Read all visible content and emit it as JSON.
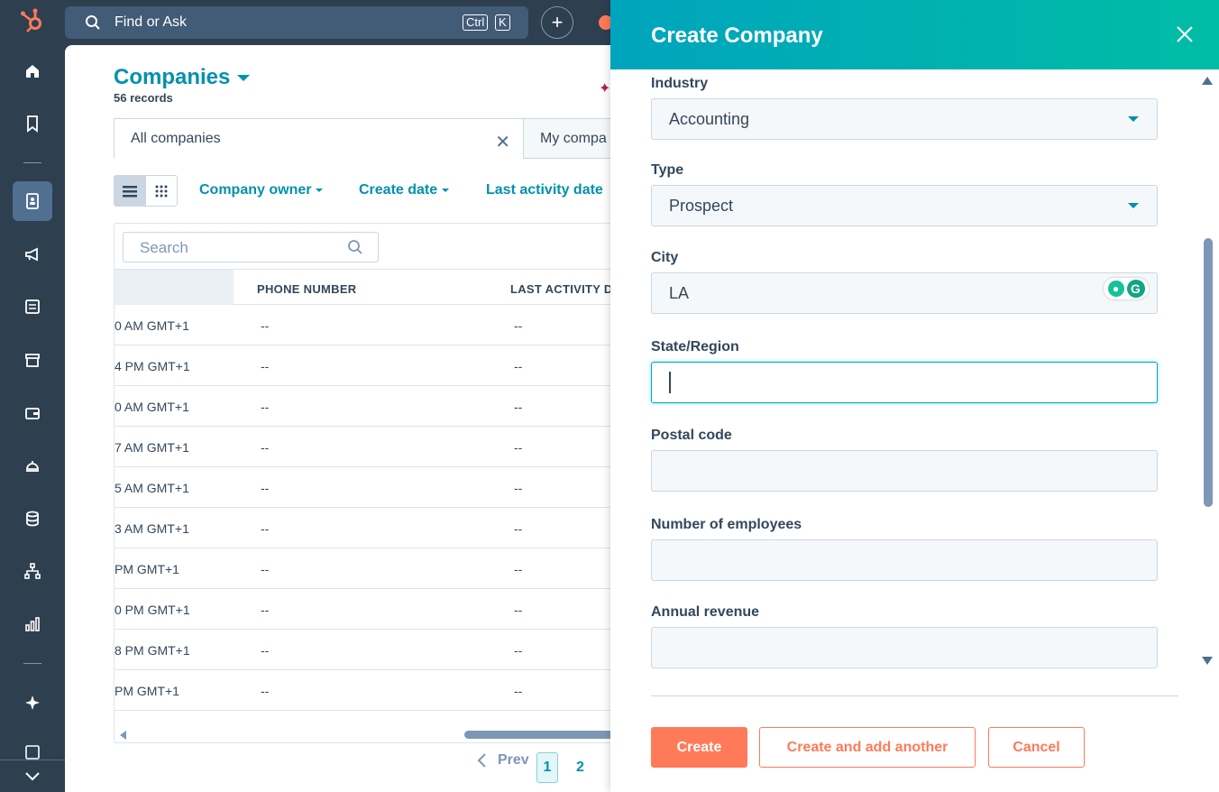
{
  "topbar": {
    "search_text": "Find or Ask",
    "shortcut_ctrl": "Ctrl",
    "shortcut_key": "K",
    "plus_label": "+"
  },
  "page": {
    "title": "Companies",
    "records": "56 records"
  },
  "views": {
    "active": "All companies",
    "other": "My compa"
  },
  "filters": {
    "owner": "Company owner",
    "create_date": "Create date",
    "last_activity": "Last activity date"
  },
  "table": {
    "search_placeholder": "Search",
    "columns": [
      "PHONE NUMBER",
      "LAST ACTIVITY D"
    ],
    "rows": [
      {
        "time": "0 AM GMT+1",
        "phone": "--",
        "activity": "--"
      },
      {
        "time": "4 PM GMT+1",
        "phone": "--",
        "activity": "--"
      },
      {
        "time": "0 AM GMT+1",
        "phone": "--",
        "activity": "--"
      },
      {
        "time": "7 AM GMT+1",
        "phone": "--",
        "activity": "--"
      },
      {
        "time": "5 AM GMT+1",
        "phone": "--",
        "activity": "--"
      },
      {
        "time": "3 AM GMT+1",
        "phone": "--",
        "activity": "--"
      },
      {
        "time": " PM GMT+1",
        "phone": "--",
        "activity": "--"
      },
      {
        "time": "0 PM GMT+1",
        "phone": "--",
        "activity": "--"
      },
      {
        "time": "8 PM GMT+1",
        "phone": "--",
        "activity": "--"
      },
      {
        "time": " PM GMT+1",
        "phone": "--",
        "activity": "--"
      }
    ]
  },
  "pagination": {
    "prev": "Prev",
    "page1": "1",
    "page2": "2"
  },
  "panel": {
    "title": "Create Company",
    "fields": {
      "industry": {
        "label": "Industry",
        "value": "Accounting"
      },
      "type": {
        "label": "Type",
        "value": "Prospect"
      },
      "city": {
        "label": "City",
        "value": "LA"
      },
      "state": {
        "label": "State/Region",
        "value": ""
      },
      "postal": {
        "label": "Postal code",
        "value": ""
      },
      "employees": {
        "label": "Number of employees",
        "value": ""
      },
      "revenue": {
        "label": "Annual revenue",
        "value": ""
      }
    },
    "buttons": {
      "create": "Create",
      "create_another": "Create and add another",
      "cancel": "Cancel"
    }
  },
  "colors": {
    "nav_bg": "#2e3f50",
    "accent": "#0091ae",
    "primary_button": "#ff7a59",
    "header_gradient_start": "#00a4bd",
    "header_gradient_end": "#00bda5"
  }
}
